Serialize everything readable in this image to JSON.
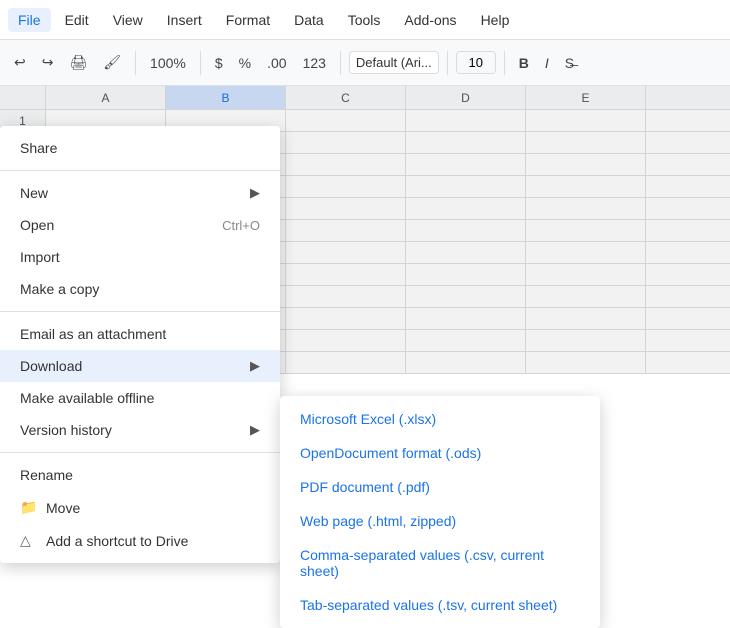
{
  "menubar": {
    "items": [
      {
        "label": "File",
        "active": true
      },
      {
        "label": "Edit"
      },
      {
        "label": "View"
      },
      {
        "label": "Insert"
      },
      {
        "label": "Format",
        "highlighted": true
      },
      {
        "label": "Data"
      },
      {
        "label": "Tools"
      },
      {
        "label": "Add-ons"
      },
      {
        "label": "Help"
      }
    ]
  },
  "toolbar": {
    "zoom": ".00",
    "zoom2": "123",
    "font": "Default (Ari...",
    "font_size": "10",
    "bold": "B",
    "italic": "I"
  },
  "columns": [
    "A",
    "B",
    "C",
    "D",
    "E"
  ],
  "file_menu": {
    "items": [
      {
        "label": "Share",
        "type": "item"
      },
      {
        "type": "divider"
      },
      {
        "label": "New",
        "type": "item",
        "hasArrow": true
      },
      {
        "label": "Open",
        "type": "item",
        "shortcut": "Ctrl+O"
      },
      {
        "label": "Import",
        "type": "item"
      },
      {
        "label": "Make a copy",
        "type": "item"
      },
      {
        "type": "divider"
      },
      {
        "label": "Email as an attachment",
        "type": "item"
      },
      {
        "label": "Download",
        "type": "item",
        "hasArrow": true,
        "active": true
      },
      {
        "label": "Make available offline",
        "type": "item"
      },
      {
        "label": "Version history",
        "type": "item",
        "hasArrow": true
      },
      {
        "type": "divider"
      },
      {
        "label": "Rename",
        "type": "item"
      },
      {
        "label": "Move",
        "type": "item",
        "icon": "folder",
        "disabled": false
      },
      {
        "label": "Add a shortcut to Drive",
        "type": "item",
        "icon": "drive"
      }
    ]
  },
  "download_submenu": {
    "items": [
      {
        "label": "Microsoft Excel (.xlsx)"
      },
      {
        "label": "OpenDocument format (.ods)"
      },
      {
        "label": "PDF document (.pdf)"
      },
      {
        "label": "Web page (.html, zipped)"
      },
      {
        "label": "Comma-separated values (.csv, current sheet)"
      },
      {
        "label": "Tab-separated values (.tsv, current sheet)"
      }
    ]
  }
}
